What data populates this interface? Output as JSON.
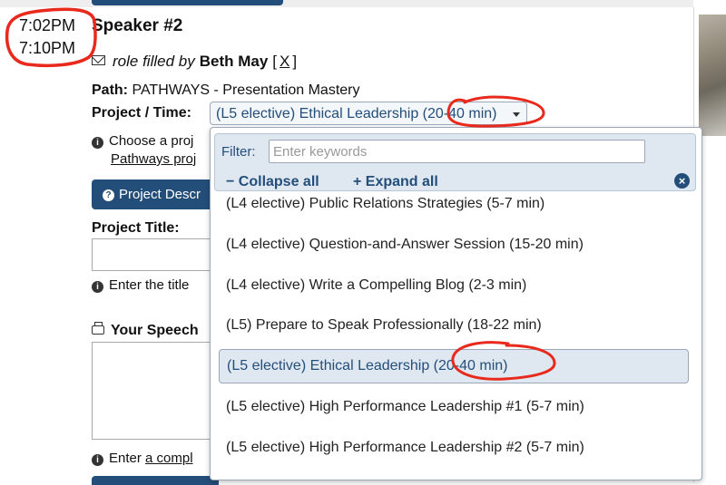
{
  "times": {
    "start": "7:02PM",
    "end": "7:10PM"
  },
  "speaker": {
    "title": "Speaker #2"
  },
  "role": {
    "prefix": "role filled by",
    "name": "Beth May",
    "bracket_open": "[",
    "remove_label": "X",
    "bracket_close": "]"
  },
  "path": {
    "label": "Path:",
    "value": "PATHWAYS - Presentation Mastery"
  },
  "project_time": {
    "label": "Project / Time:",
    "selected": "(L5 elective) Ethical Leadership (20-40 min)"
  },
  "info": {
    "line1": "Choose a proj",
    "line2": "Pathways proj"
  },
  "desc_button": {
    "label": "Project Descr"
  },
  "project_title": {
    "label": "Project Title:",
    "hint": "Enter the title"
  },
  "speech": {
    "label": "Your Speech"
  },
  "enter_complete": {
    "prefix": "Enter",
    "link": "a compl"
  },
  "dropdown": {
    "filter_label": "Filter:",
    "filter_placeholder": "Enter keywords",
    "collapse_all": "− Collapse all",
    "expand_all": "+ Expand all",
    "close_symbol": "×",
    "options": [
      "(L4 elective) Public Relations Strategies (5-7 min)",
      "(L4 elective) Question-and-Answer Session (15-20 min)",
      "(L4 elective) Write a Compelling Blog (2-3 min)",
      "(L5) Prepare to Speak Professionally (18-22 min)",
      "(L5 elective) Ethical Leadership (20-40 min)",
      "(L5 elective) High Performance Leadership #1 (5-7 min)",
      "(L5 elective) High Performance Leadership #2 (5-7 min)"
    ],
    "selected_index": 4
  },
  "colors": {
    "accent": "#244e7a",
    "highlight": "#dfe8f1",
    "annotation": "#e8291c"
  }
}
